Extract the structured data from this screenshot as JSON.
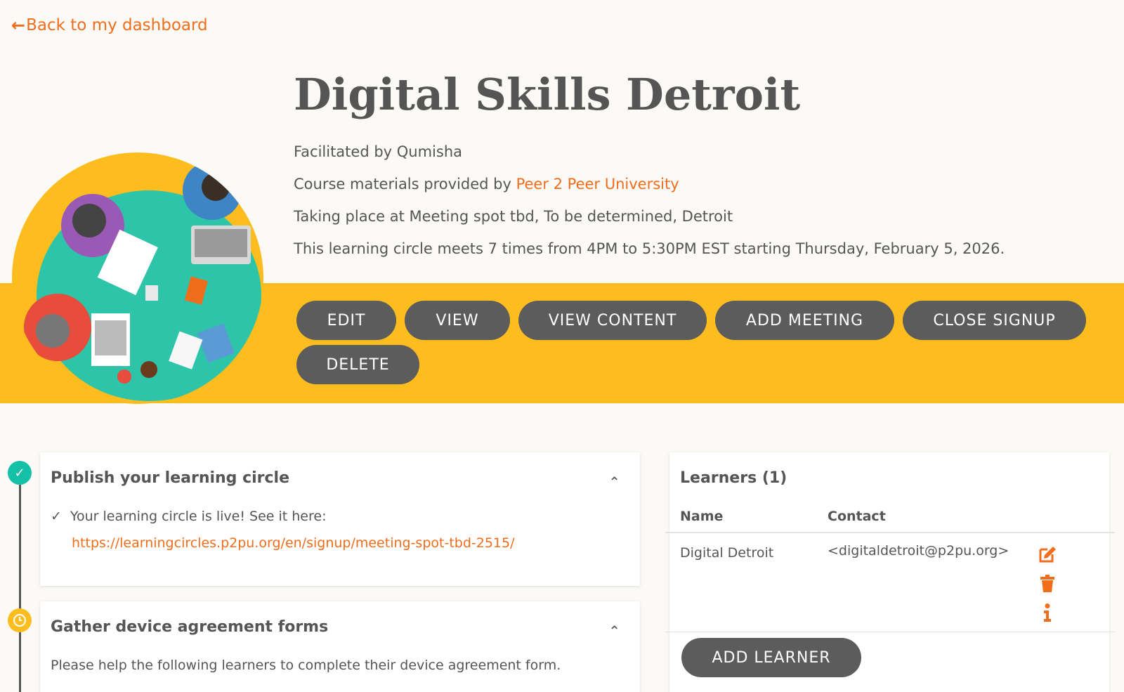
{
  "back_link": {
    "label": "Back to my dashboard"
  },
  "course": {
    "title": "Digital Skills Detroit",
    "facilitated": "Facilitated by Qumisha",
    "materials_prefix": "Course materials provided by ",
    "materials_link": "Peer 2 Peer University",
    "location": "Taking place at Meeting spot tbd, To be determined, Detroit",
    "schedule": "This learning circle meets 7 times from 4PM to 5:30PM EST starting Thursday, February 5, 2026."
  },
  "actions": {
    "edit": "EDIT",
    "view": "VIEW",
    "view_content": "VIEW CONTENT",
    "add_meeting": "ADD MEETING",
    "close_signup": "CLOSE SIGNUP",
    "delete": "DELETE"
  },
  "tasks": [
    {
      "title": "Publish your learning circle",
      "status": "done",
      "check_text": "Your learning circle is live! See it here:",
      "link": "https://learningcircles.p2pu.org/en/signup/meeting-spot-tbd-2515/"
    },
    {
      "title": "Gather device agreement forms",
      "status": "pending",
      "body": "Please help the following learners to complete their device agreement form."
    }
  ],
  "learners": {
    "title": "Learners (1)",
    "columns": [
      "Name",
      "Contact"
    ],
    "rows": [
      {
        "name": "Digital Detroit",
        "contact": "<digitaldetroit@p2pu.org>"
      }
    ],
    "row_icons": [
      "edit-icon",
      "trash-icon",
      "info-icon"
    ],
    "add_button": "ADD LEARNER"
  },
  "colors": {
    "accent": "#f06d1c",
    "band": "#fdbd1e",
    "button": "#5c5c5c",
    "done": "#14c0a8"
  }
}
